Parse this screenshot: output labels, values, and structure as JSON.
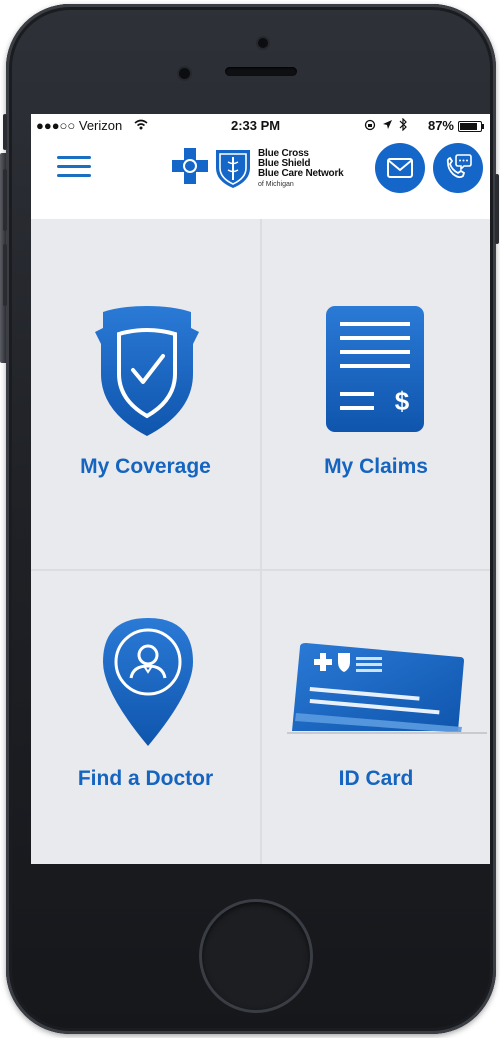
{
  "status_bar": {
    "carrier": "●●●○○ Verizon",
    "time": "2:33 PM",
    "battery": "87%",
    "battery_level": 0.87
  },
  "header": {
    "logo_lines": [
      "Blue Cross",
      "Blue Shield",
      "Blue Care Network"
    ],
    "logo_sub": "of Michigan",
    "menu_icon": "hamburger-menu-icon",
    "mail_icon": "envelope-icon",
    "chat_icon": "phone-chat-icon"
  },
  "tiles": [
    {
      "label": "My Coverage",
      "icon": "shield-check-icon"
    },
    {
      "label": "My Claims",
      "icon": "claims-document-icon"
    },
    {
      "label": "Find a Doctor",
      "icon": "doctor-location-pin-icon"
    },
    {
      "label": "ID Card",
      "icon": "id-card-icon"
    }
  ],
  "colors": {
    "brand_blue": "#1466c8",
    "label_blue": "#1464c0",
    "tile_background": "#e9eaed",
    "phone_body": "#1f2126"
  }
}
